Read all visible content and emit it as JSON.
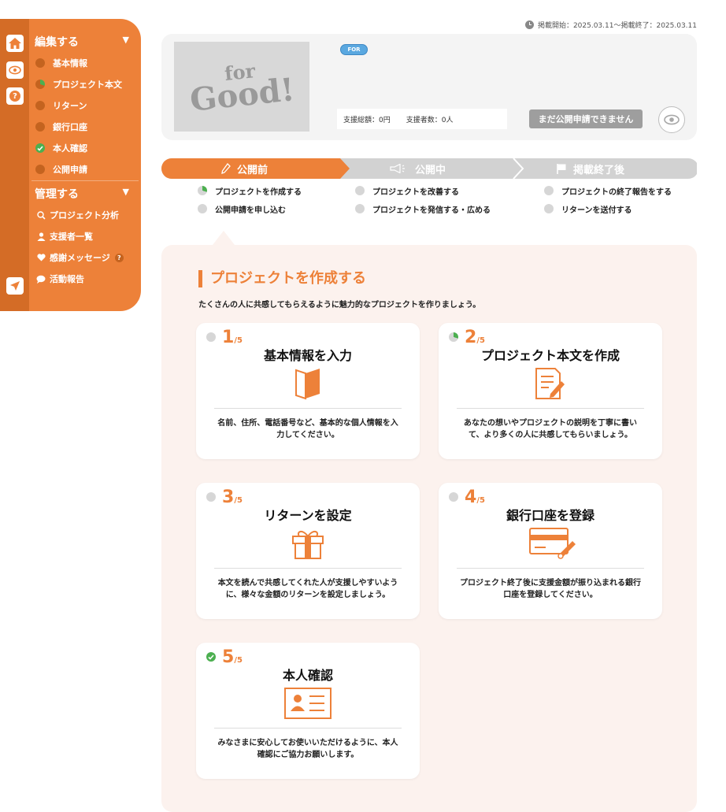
{
  "colors": {
    "accent": "#ED8139",
    "accent_dark": "#D46C26",
    "done": "#4CAF50",
    "pending": "#D6D6D6",
    "panel_bg": "#FCF2EE"
  },
  "sidebar": {
    "edit_heading": "編集する",
    "edit_items": [
      {
        "label": "基本情報",
        "status": "none"
      },
      {
        "label": "プロジェクト本文",
        "status": "partial"
      },
      {
        "label": "リターン",
        "status": "none"
      },
      {
        "label": "銀行口座",
        "status": "none"
      },
      {
        "label": "本人確認",
        "status": "done"
      },
      {
        "label": "公開申請",
        "status": "none"
      }
    ],
    "manage_heading": "管理する",
    "manage_items": [
      {
        "label": "プロジェクト分析",
        "icon": "search-icon"
      },
      {
        "label": "支援者一覧",
        "icon": "person-icon"
      },
      {
        "label": "感謝メッセージ",
        "icon": "heart-icon",
        "help": "?"
      },
      {
        "label": "活動報告",
        "icon": "speech-bubble-icon"
      }
    ],
    "rail_icons": [
      "home-icon",
      "eye-icon",
      "help-icon",
      "send-icon"
    ],
    "help_glyph": "?"
  },
  "header": {
    "period": "掲載開始：2025.03.11〜掲載終了：2025.03.11"
  },
  "project": {
    "logo_top": "for",
    "logo_bottom": "Good!",
    "badge": "FOR",
    "total_label": "支援総額：",
    "total_value": "0円",
    "supporters_label": "支援者数：",
    "supporters_value": "0人",
    "apply_button": "まだ公開申請できません"
  },
  "stepper": {
    "steps": [
      {
        "label": "公開前",
        "icon": "pencil-icon",
        "active": true
      },
      {
        "label": "公開中",
        "icon": "megaphone-icon",
        "active": false
      },
      {
        "label": "掲載終了後",
        "icon": "flag-icon",
        "active": false
      }
    ],
    "tasks": [
      [
        {
          "label": "プロジェクトを作成する",
          "status": "partial"
        },
        {
          "label": "公開申請を申し込む",
          "status": "none"
        }
      ],
      [
        {
          "label": "プロジェクトを改善する",
          "status": "none"
        },
        {
          "label": "プロジェクトを発信する・広める",
          "status": "none"
        }
      ],
      [
        {
          "label": "プロジェクトの終了報告をする",
          "status": "none"
        },
        {
          "label": "リターンを送付する",
          "status": "none"
        }
      ]
    ]
  },
  "section": {
    "title": "プロジェクトを作成する",
    "description": "たくさんの人に共感してもらえるように魅力的なプロジェクトを作りましょう。"
  },
  "cards": [
    {
      "step": "1",
      "total": "/5",
      "title": "基本情報を入力",
      "icon": "book-icon",
      "status": "none",
      "desc": "名前、住所、電話番号など、基本的な個人情報を入力してください。"
    },
    {
      "step": "2",
      "total": "/5",
      "title": "プロジェクト本文を作成",
      "icon": "document-edit-icon",
      "status": "partial",
      "desc": "あなたの想いやプロジェクトの説明を丁寧に書いて、より多くの人に共感してもらいましょう。"
    },
    {
      "step": "3",
      "total": "/5",
      "title": "リターンを設定",
      "icon": "gift-icon",
      "status": "none",
      "desc": "本文を読んで共感してくれた人が支援しやすいように、様々な金額のリターンを設定しましょう。"
    },
    {
      "step": "4",
      "total": "/5",
      "title": "銀行口座を登録",
      "icon": "credit-card-icon",
      "status": "none",
      "desc": "プロジェクト終了後に支援金額が振り込まれる銀行口座を登録してください。"
    },
    {
      "step": "5",
      "total": "/5",
      "title": "本人確認",
      "icon": "id-card-icon",
      "status": "done",
      "desc": "みなさまに安心してお使いいただけるように、本人確認にご協力お願いします。"
    }
  ]
}
